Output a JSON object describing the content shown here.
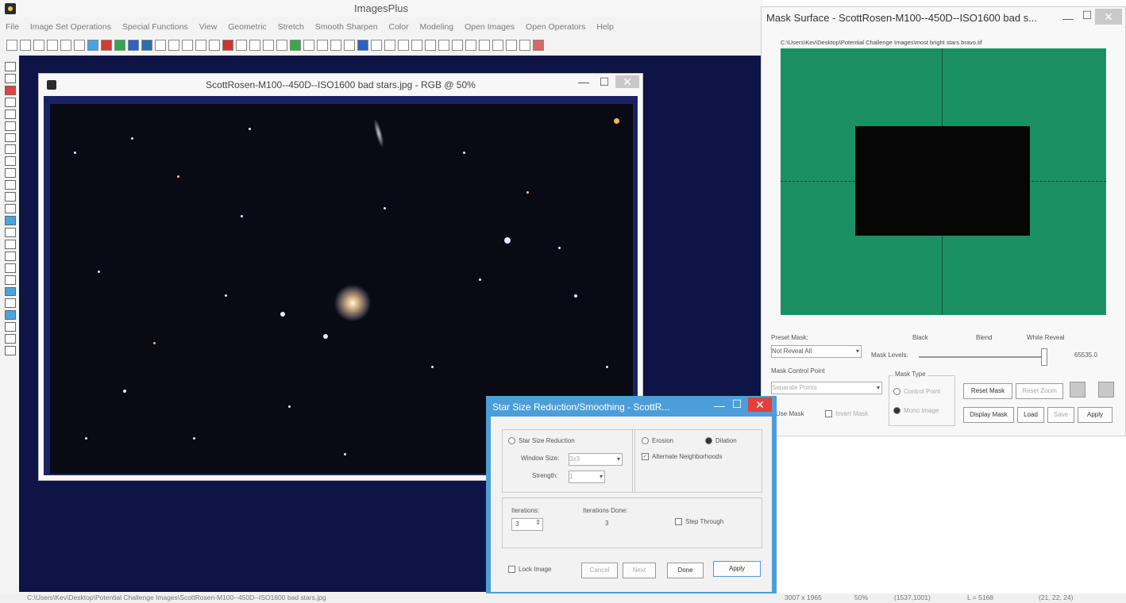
{
  "app": {
    "title": "ImagesPlus",
    "menu": [
      "File",
      "Image Set Operations",
      "Special Functions",
      "View",
      "Geometric",
      "Stretch",
      "Smooth Sharpen",
      "Color",
      "Modeling",
      "Open Images",
      "Open Operators",
      "Help"
    ]
  },
  "image_window": {
    "title": "ScottRosen-M100--450D--ISO1600 bad stars.jpg - RGB @ 50%"
  },
  "mask_panel": {
    "title": "Mask Surface - ScottRosen-M100--450D--ISO1600 bad s...",
    "path": "C:\\Users\\Kev\\Desktop\\Potential Challenge Images\\most bright stars bravo.tif",
    "preset_mask_label": "Preset Mask:",
    "preset_mask_value": "Not Reveal All",
    "mask_levels_label": "Mask Levels:",
    "black_label": "Black",
    "blend_label": "Blend",
    "white_label": "White Reveal",
    "level_value": "65535.0",
    "control_point_label": "Mask Control Point",
    "control_point_value": "Separate Points",
    "mask_type_label": "Mask Type",
    "mask_type_option1": "Control Point",
    "mask_type_option2": "Mono Image",
    "use_mask_label": "Use Mask",
    "invert_mask_label": "Invert Mask",
    "buttons": {
      "reset_mask": "Reset Mask",
      "reset_zoom": "Reset Zoom",
      "display_mask": "Display Mask",
      "load": "Load",
      "save": "Save",
      "apply": "Apply"
    }
  },
  "dialog": {
    "title": "Star Size Reduction/Smoothing - ScottR...",
    "star_size_reduction": "Star Size Reduction",
    "window_size_label": "Window Size:",
    "window_size_value": "3x3",
    "strength_label": "Strength:",
    "strength_value": "1",
    "erosion": "Erosion",
    "dilation": "Dilation",
    "alternate": "Alternate Neighborhoods",
    "iterations_label": "Iterations:",
    "iterations_value": "3",
    "iterations_done_label": "Iterations Done:",
    "iterations_done_value": "3",
    "step_through": "Step Through",
    "lock_image": "Lock Image",
    "buttons": {
      "cancel": "Cancel",
      "next": "Next",
      "done": "Done",
      "apply": "Apply"
    }
  },
  "status": {
    "path": "C:\\Users\\Kev\\Desktop\\Potential Challenge Images\\ScottRosen-M100--450D--ISO1600 bad stars.jpg",
    "dims": "3007 x 1965",
    "zoom": "50%",
    "coord": "(1537,1001)",
    "level": "L = 5168",
    "rgb": "(21, 22, 24)"
  },
  "colors": {
    "desktop": "#0e1446",
    "mask_green": "#1b9163",
    "dialog_frame": "#4b9ed8",
    "close_red": "#e0413d"
  }
}
